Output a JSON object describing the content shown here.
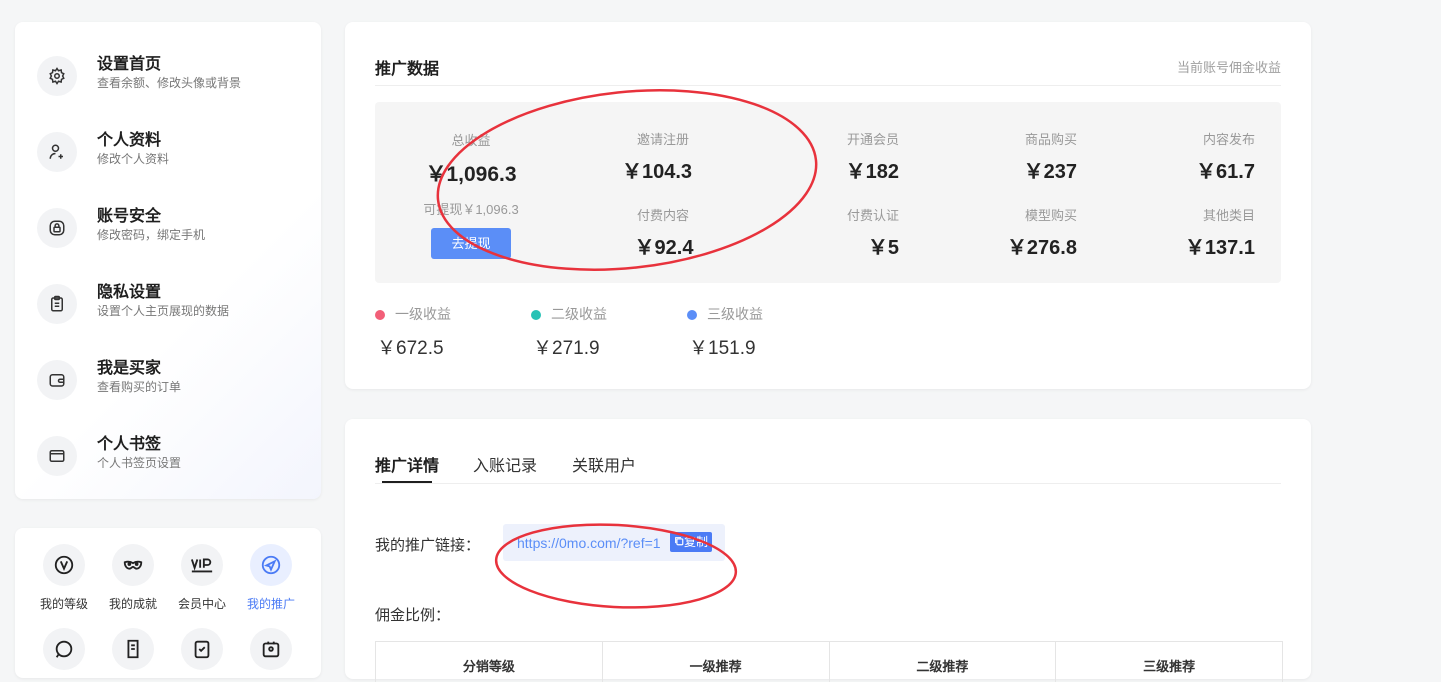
{
  "sidebar": {
    "items": [
      {
        "title": "设置首页",
        "desc": "查看余额、修改头像或背景",
        "icon": "gear-icon"
      },
      {
        "title": "个人资料",
        "desc": "修改个人资料",
        "icon": "user-edit-icon"
      },
      {
        "title": "账号安全",
        "desc": "修改密码，绑定手机",
        "icon": "lock-icon"
      },
      {
        "title": "隐私设置",
        "desc": "设置个人主页展现的数据",
        "icon": "clipboard-icon"
      },
      {
        "title": "我是买家",
        "desc": "查看购买的订单",
        "icon": "wallet-icon"
      },
      {
        "title": "个人书签",
        "desc": "个人书签页设置",
        "icon": "bookmark-card-icon"
      }
    ]
  },
  "shortcuts": [
    {
      "label": "我的等级",
      "icon": "level-v-icon",
      "active": false
    },
    {
      "label": "我的成就",
      "icon": "mask-icon",
      "active": false
    },
    {
      "label": "会员中心",
      "icon": "vip-icon",
      "active": false
    },
    {
      "label": "我的推广",
      "icon": "send-icon",
      "active": true
    }
  ],
  "promo": {
    "title": "推广数据",
    "note": "当前账号佣金收益",
    "total_label": "总收益",
    "total_value": "￥1,096.3",
    "withdrawable": "可提现￥1,096.3",
    "withdraw_button": "去提现",
    "stats_top": [
      {
        "label": "邀请注册",
        "value": "￥104.3"
      },
      {
        "label": "开通会员",
        "value": "￥182"
      },
      {
        "label": "商品购买",
        "value": "￥237"
      },
      {
        "label": "内容发布",
        "value": "￥61.7"
      }
    ],
    "stats_bottom": [
      {
        "label": "付费内容",
        "value": "￥92.4"
      },
      {
        "label": "付费认证",
        "value": "￥5"
      },
      {
        "label": "模型购买",
        "value": "￥276.8"
      },
      {
        "label": "其他类目",
        "value": "￥137.1"
      }
    ],
    "levels": [
      {
        "label": "一级收益",
        "value": "￥672.5",
        "color": "#f25f78"
      },
      {
        "label": "二级收益",
        "value": "￥271.9",
        "color": "#27c2b5"
      },
      {
        "label": "三级收益",
        "value": "￥151.9",
        "color": "#5b8ef7"
      }
    ]
  },
  "detail": {
    "tabs": [
      "推广详情",
      "入账记录",
      "关联用户"
    ],
    "link_label": "我的推广链接：",
    "link_url": "https://0mo.com/?ref=1",
    "copy_label": "复制",
    "ratio_label": "佣金比例：",
    "table_headers": [
      "分销等级",
      "一级推荐",
      "二级推荐",
      "三级推荐"
    ]
  },
  "colors": {
    "accent": "#5b8ef7",
    "annotation": "#e8323c"
  }
}
